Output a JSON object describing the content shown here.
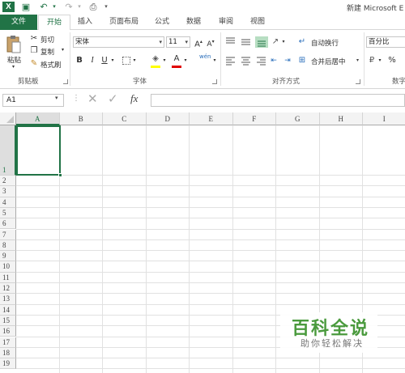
{
  "app": {
    "logo": "X",
    "title": "新建 Microsoft E"
  },
  "tabs": [
    "文件",
    "开始",
    "插入",
    "页面布局",
    "公式",
    "数据",
    "审阅",
    "视图"
  ],
  "clipboard": {
    "paste": "粘贴",
    "cut": "剪切",
    "copy": "复制",
    "format_painter": "格式刷",
    "label": "剪贴板"
  },
  "font": {
    "name": "宋体",
    "size": "11",
    "grow": "A",
    "shrink": "A",
    "bold": "B",
    "italic": "I",
    "underline": "U",
    "label": "字体",
    "wen": "wén"
  },
  "alignment": {
    "wrap_text": "自动换行",
    "merge_center": "合并后居中",
    "label": "对齐方式"
  },
  "number": {
    "format": "百分比",
    "percent": "%",
    "label": "数字"
  },
  "formula_bar": {
    "cell_ref": "A1",
    "fx": "fx",
    "value": ""
  },
  "columns": [
    "A",
    "B",
    "C",
    "D",
    "E",
    "F",
    "G",
    "H",
    "I"
  ],
  "rows": [
    "1",
    "2",
    "3",
    "4",
    "5",
    "6",
    "7",
    "8",
    "9",
    "10",
    "11",
    "12",
    "13",
    "14",
    "15",
    "16",
    "17",
    "18",
    "19"
  ],
  "watermark": {
    "title": "百科全说",
    "subtitle": "助你轻松解决"
  },
  "colors": {
    "accent": "#217346",
    "watermark_green": "#4a9a3d"
  }
}
